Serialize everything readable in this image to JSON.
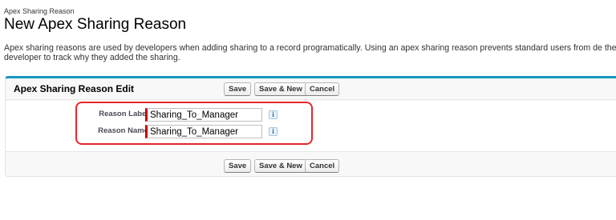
{
  "header": {
    "breadcrumb": "Apex Sharing Reason",
    "title": "New Apex Sharing Reason",
    "description": "Apex sharing reasons are used by developers when adding sharing to a record programatically. Using an apex sharing reason prevents standard users from de the developer to track why they added the sharing."
  },
  "panel": {
    "title": "Apex Sharing Reason Edit",
    "top_buttons": {
      "save": "Save",
      "save_new": "Save & New",
      "cancel": "Cancel"
    },
    "bottom_buttons": {
      "save": "Save",
      "save_new": "Save & New",
      "cancel": "Cancel"
    }
  },
  "fields": {
    "reason_label": {
      "label": "Reason Label",
      "value": "Sharing_To_Manager",
      "info_icon": "i"
    },
    "reason_name": {
      "label": "Reason Name",
      "value": "Sharing_To_Manager",
      "info_icon": "i"
    }
  },
  "colors": {
    "panel_top_border": "#1797c0",
    "required_bar": "#cc0000",
    "highlight": "#e5262b"
  }
}
